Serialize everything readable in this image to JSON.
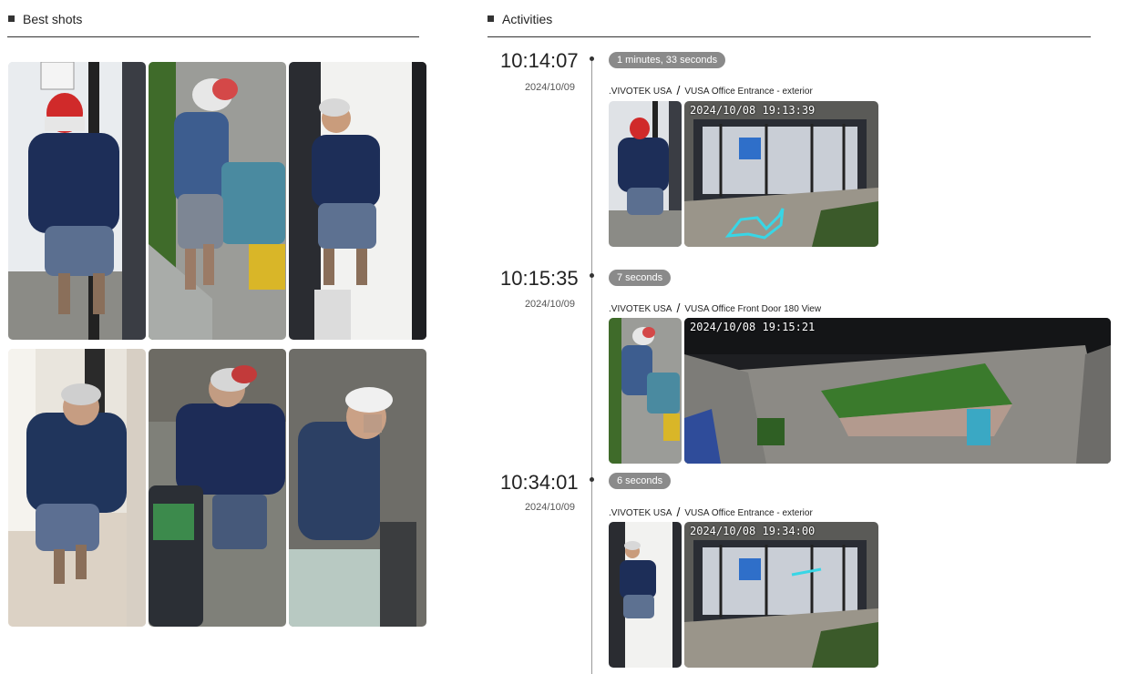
{
  "best_shots": {
    "title": "Best shots"
  },
  "activities": {
    "title": "Activities",
    "items": [
      {
        "time": "10:14:07",
        "date": "2024/10/09",
        "duration": "1 minutes, 33 seconds",
        "org": ".VIVOTEK USA",
        "camera": "VUSA Office Entrance - exterior",
        "cam_timestamp": "2024/10/08 19:13:39"
      },
      {
        "time": "10:15:35",
        "date": "2024/10/09",
        "duration": "7 seconds",
        "org": ".VIVOTEK USA",
        "camera": "VUSA Office Front Door 180 View",
        "cam_timestamp": "2024/10/08 19:15:21"
      },
      {
        "time": "10:34:01",
        "date": "2024/10/09",
        "duration": "6 seconds",
        "org": ".VIVOTEK USA",
        "camera": "VUSA Office Entrance - exterior",
        "cam_timestamp": "2024/10/08 19:34:00"
      }
    ]
  },
  "colors": {
    "badge_bg": "#8a8a8a",
    "trail": "#38d6e6"
  }
}
